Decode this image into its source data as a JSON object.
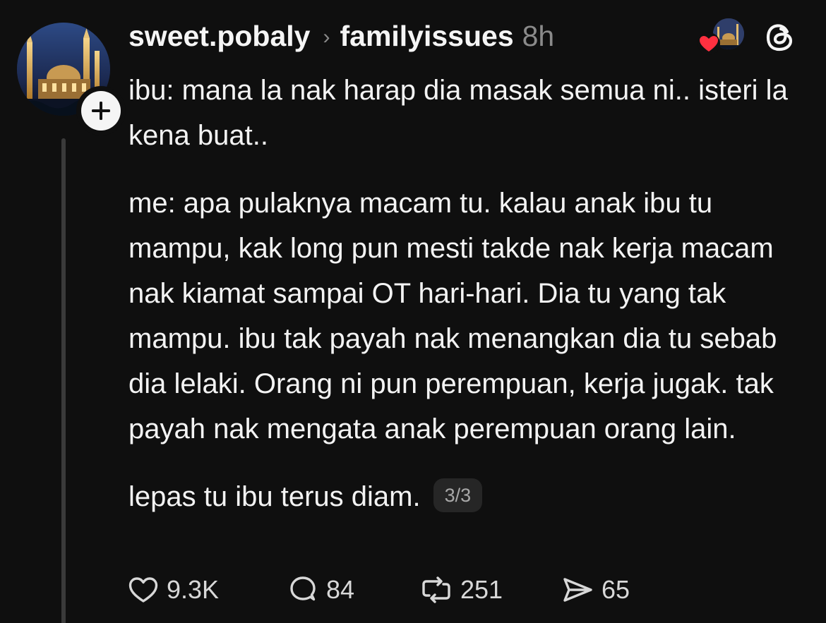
{
  "post": {
    "author": {
      "username": "sweet.pobaly",
      "avatar_icon": "mosque-night-avatar",
      "follow_icon": "plus-icon"
    },
    "breadcrumb_separator": "›",
    "community": "familyissues",
    "time": "8h",
    "liked_by_icon": "heart-icon",
    "paragraphs": [
      "ibu: mana la nak harap dia  masak semua ni.. isteri la kena buat..",
      "me: apa pulaknya macam tu. kalau anak ibu tu mampu, kak long pun mesti takde nak kerja macam nak kiamat sampai OT hari-hari. Dia tu yang tak mampu. ibu tak payah nak menangkan dia tu sebab dia lelaki. Orang ni pun perempuan, kerja jugak. tak payah nak mengata anak perempuan orang lain.",
      "lepas tu ibu terus diam."
    ],
    "page_indicator": "3/3",
    "stats": {
      "likes": "9.3K",
      "replies": "84",
      "reposts": "251",
      "shares": "65"
    },
    "colors": {
      "background": "#0f0f0f",
      "text": "#f3f3f3",
      "muted": "#8a8a8a",
      "heart": "#ff3040"
    }
  }
}
